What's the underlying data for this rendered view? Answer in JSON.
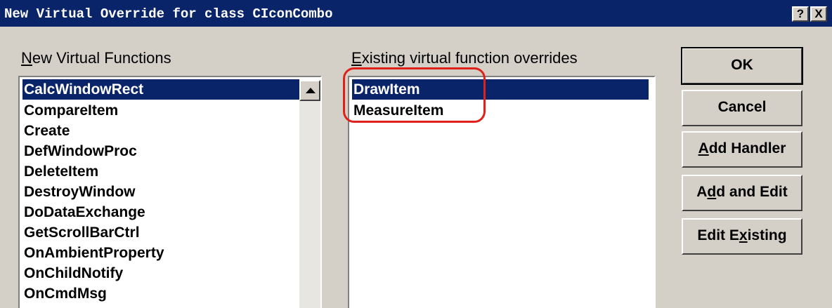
{
  "window": {
    "title": "New Virtual Override for class CIconCombo",
    "help_button": "?",
    "close_button": "X"
  },
  "new_functions": {
    "label_mnemonic": "N",
    "label_rest": "ew Virtual Functions",
    "items": [
      "CalcWindowRect",
      "CompareItem",
      "Create",
      "DefWindowProc",
      "DeleteItem",
      "DestroyWindow",
      "DoDataExchange",
      "GetScrollBarCtrl",
      "OnAmbientProperty",
      "OnChildNotify",
      "OnCmdMsg"
    ],
    "selected": "CalcWindowRect"
  },
  "existing_overrides": {
    "label_mnemonic": "E",
    "label_rest": "xisting virtual function overrides",
    "items": [
      "DrawItem",
      "MeasureItem"
    ],
    "selected": "DrawItem"
  },
  "buttons": {
    "ok": "OK",
    "cancel": "Cancel",
    "add_handler_mnemonic": "A",
    "add_handler_rest": "dd Handler",
    "add_edit_pre": "A",
    "add_edit_mnemonic": "d",
    "add_edit_rest": "d and Edit",
    "edit_existing_pre": "Edit E",
    "edit_existing_mnemonic": "x",
    "edit_existing_rest": "isting"
  },
  "annotation_color": "#e0201a",
  "selection_color": "#0a246a"
}
